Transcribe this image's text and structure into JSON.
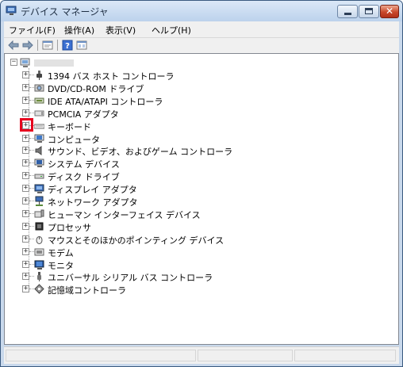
{
  "window": {
    "title": "デバイス マネージャ",
    "close_glyph": "✕"
  },
  "menu": [
    {
      "label": "ファイル(F)"
    },
    {
      "label": "操作(A)"
    },
    {
      "label": "表示(V)"
    },
    {
      "label": "ヘルプ(H)"
    }
  ],
  "toolbar_icons": [
    "back-arrow-icon",
    "forward-arrow-icon",
    "properties-icon",
    "help-icon",
    "view-icon"
  ],
  "tree": {
    "root_expander": "−",
    "node_expander": "+",
    "items": [
      {
        "label": "1394 バス ホスト コントローラ",
        "icon": "plug-icon"
      },
      {
        "label": "DVD/CD-ROM ドライブ",
        "icon": "cdrom-icon"
      },
      {
        "label": "IDE ATA/ATAPI コントローラ",
        "icon": "ide-controller-icon"
      },
      {
        "label": "PCMCIA アダプタ",
        "icon": "pcmcia-icon"
      },
      {
        "label": "キーボード",
        "icon": "keyboard-icon"
      },
      {
        "label": "コンピュータ",
        "icon": "computer-icon"
      },
      {
        "label": "サウンド、ビデオ、およびゲーム コントローラ",
        "icon": "speaker-icon"
      },
      {
        "label": "システム デバイス",
        "icon": "system-device-icon"
      },
      {
        "label": "ディスク ドライブ",
        "icon": "disk-drive-icon"
      },
      {
        "label": "ディスプレイ アダプタ",
        "icon": "display-adapter-icon"
      },
      {
        "label": "ネットワーク アダプタ",
        "icon": "network-adapter-icon"
      },
      {
        "label": "ヒューマン インターフェイス デバイス",
        "icon": "hid-icon"
      },
      {
        "label": "プロセッサ",
        "icon": "processor-icon"
      },
      {
        "label": "マウスとそのほかのポインティング デバイス",
        "icon": "mouse-icon"
      },
      {
        "label": "モデム",
        "icon": "modem-icon"
      },
      {
        "label": "モニタ",
        "icon": "monitor-icon"
      },
      {
        "label": "ユニバーサル シリアル バス コントローラ",
        "icon": "usb-icon"
      },
      {
        "label": "記憶域コントローラ",
        "icon": "storage-controller-icon"
      }
    ]
  },
  "colors": {
    "highlight_box": "#e6001e",
    "title_bar": "#c9d9ec",
    "close_button": "#c9472b"
  }
}
